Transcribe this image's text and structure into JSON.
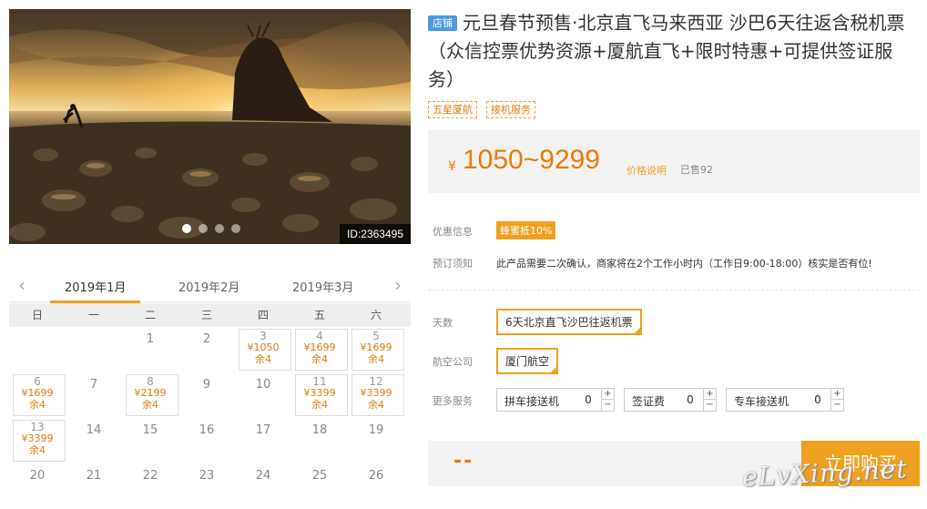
{
  "hero": {
    "image_id": "ID:2363495",
    "slides": 4,
    "active_slide": 0
  },
  "calendar": {
    "prev_icon": "chevron-left-icon",
    "next_icon": "chevron-right-icon",
    "months": [
      "2019年1月",
      "2019年2月",
      "2019年3月"
    ],
    "active_month": 0,
    "weekdays": [
      "日",
      "一",
      "二",
      "三",
      "四",
      "五",
      "六"
    ],
    "days": [
      {
        "d": "",
        "p": "",
        "s": ""
      },
      {
        "d": "",
        "p": "",
        "s": ""
      },
      {
        "d": "1",
        "p": "",
        "s": ""
      },
      {
        "d": "2",
        "p": "",
        "s": ""
      },
      {
        "d": "3",
        "p": "¥1050",
        "s": "余4"
      },
      {
        "d": "4",
        "p": "¥1699",
        "s": "余4"
      },
      {
        "d": "5",
        "p": "¥1699",
        "s": "余4"
      },
      {
        "d": "6",
        "p": "¥1699",
        "s": "余4"
      },
      {
        "d": "7",
        "p": "",
        "s": ""
      },
      {
        "d": "8",
        "p": "¥2199",
        "s": "余4"
      },
      {
        "d": "9",
        "p": "",
        "s": ""
      },
      {
        "d": "10",
        "p": "",
        "s": ""
      },
      {
        "d": "11",
        "p": "¥3399",
        "s": "余4"
      },
      {
        "d": "12",
        "p": "¥3399",
        "s": "余4"
      },
      {
        "d": "13",
        "p": "¥3399",
        "s": "余4"
      },
      {
        "d": "14",
        "p": "",
        "s": ""
      },
      {
        "d": "15",
        "p": "",
        "s": ""
      },
      {
        "d": "16",
        "p": "",
        "s": ""
      },
      {
        "d": "17",
        "p": "",
        "s": ""
      },
      {
        "d": "18",
        "p": "",
        "s": ""
      },
      {
        "d": "19",
        "p": "",
        "s": ""
      },
      {
        "d": "20",
        "p": "",
        "s": ""
      },
      {
        "d": "21",
        "p": "",
        "s": ""
      },
      {
        "d": "22",
        "p": "",
        "s": ""
      },
      {
        "d": "23",
        "p": "",
        "s": ""
      },
      {
        "d": "24",
        "p": "",
        "s": ""
      },
      {
        "d": "25",
        "p": "",
        "s": ""
      },
      {
        "d": "26",
        "p": "",
        "s": ""
      }
    ]
  },
  "product": {
    "shop_badge": "店铺",
    "title": "元旦春节预售·北京直飞马来西亚 沙巴6天往返含税机票（众信控票优势资源+厦航直飞+限时特惠+可提供签证服务）",
    "tags": [
      "五星厦航",
      "接机服务"
    ]
  },
  "price": {
    "currency": "¥",
    "range": "1050~9299",
    "explain_link": "价格说明",
    "sold": "已售92"
  },
  "info": {
    "discount_label": "优惠信息",
    "discount_badge": "蜂蜜抵10%",
    "notice_label": "预订须知",
    "notice_text": "此产品需要二次确认，商家将在2个工作小时内（工作日9:00-18:00）核实是否有位!"
  },
  "options": {
    "days_label": "天数",
    "days_value": "6天北京直飞沙巴往返机票",
    "airline_label": "航空公司",
    "airline_value": "厦门航空",
    "extras_label": "更多服务",
    "extras": [
      {
        "name": "拼车接送机",
        "qty": "0"
      },
      {
        "name": "签证费",
        "qty": "0"
      },
      {
        "name": "专车接送机",
        "qty": "0"
      }
    ],
    "plus": "+",
    "minus": "−"
  },
  "purchase": {
    "total": "--",
    "buy_button": "立即购买"
  },
  "watermark": "eLvXing.net",
  "colors": {
    "accent": "#f0a020",
    "price": "#f07800",
    "badge_blue": "#4a9be0"
  }
}
